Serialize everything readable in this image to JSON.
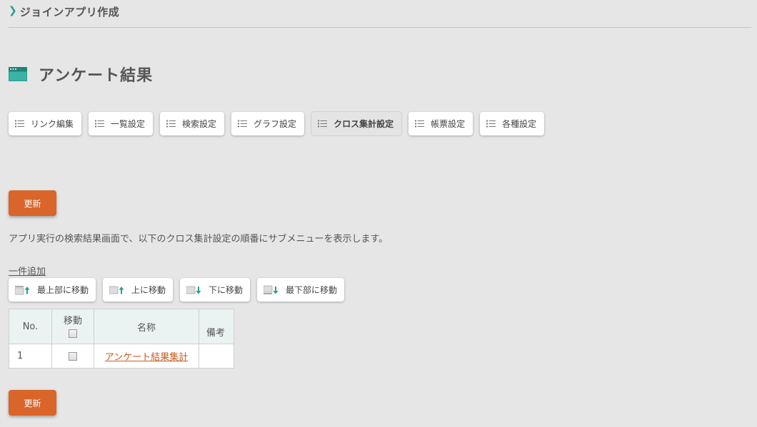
{
  "breadcrumb": {
    "chevron": "chevron-right-icon",
    "label": "ジョインアプリ作成"
  },
  "page": {
    "title": "アンケート結果",
    "icon": "window-icon"
  },
  "tabs": [
    {
      "label": "リンク編集",
      "icon": "list-icon",
      "active": false
    },
    {
      "label": "一覧設定",
      "icon": "list-icon",
      "active": false
    },
    {
      "label": "検索設定",
      "icon": "list-icon",
      "active": false
    },
    {
      "label": "グラフ設定",
      "icon": "list-icon",
      "active": false
    },
    {
      "label": "クロス集計設定",
      "icon": "list-icon",
      "active": true
    },
    {
      "label": "帳票設定",
      "icon": "list-icon",
      "active": false
    },
    {
      "label": "各種設定",
      "icon": "list-icon",
      "active": false
    }
  ],
  "update_label": "更新",
  "description": "アプリ実行の検索結果画面で、以下のクロス集計設定の順番にサブメニューを表示します。",
  "add_link": "一件追加",
  "move_buttons": [
    {
      "label": "最上部に移動",
      "icon": "move-top-icon"
    },
    {
      "label": "上に移動",
      "icon": "move-up-icon"
    },
    {
      "label": "下に移動",
      "icon": "move-down-icon"
    },
    {
      "label": "最下部に移動",
      "icon": "move-bottom-icon"
    }
  ],
  "table": {
    "headers": {
      "no": "No.",
      "move": "移動",
      "name": "名称",
      "note": "備考"
    },
    "rows": [
      {
        "no": "1",
        "name": "アンケート結果集計",
        "note": ""
      }
    ]
  },
  "colors": {
    "accent": "#2a9d8f",
    "button": "#d9652a",
    "link": "#c65a1e",
    "header_bg": "#eaf3f2"
  }
}
